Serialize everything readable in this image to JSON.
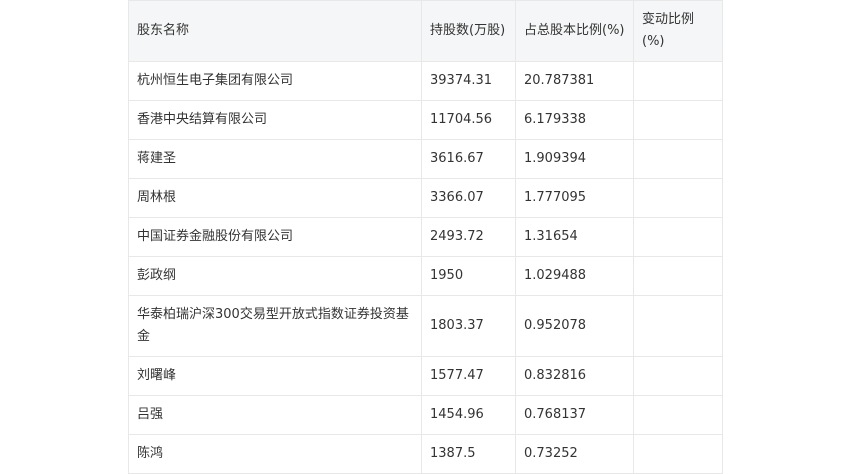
{
  "table": {
    "headers": [
      "股东名称",
      "持股数(万股)",
      "占总股本比例(%)",
      "变动比例(%)"
    ],
    "rows": [
      {
        "name": "杭州恒生电子集团有限公司",
        "shares": "39374.31",
        "ratio": "20.787381",
        "change": ""
      },
      {
        "name": "香港中央结算有限公司",
        "shares": "11704.56",
        "ratio": "6.179338",
        "change": ""
      },
      {
        "name": "蒋建圣",
        "shares": "3616.67",
        "ratio": "1.909394",
        "change": ""
      },
      {
        "name": "周林根",
        "shares": "3366.07",
        "ratio": "1.777095",
        "change": ""
      },
      {
        "name": "中国证券金融股份有限公司",
        "shares": "2493.72",
        "ratio": "1.31654",
        "change": ""
      },
      {
        "name": "彭政纲",
        "shares": "1950",
        "ratio": "1.029488",
        "change": ""
      },
      {
        "name": "华泰柏瑞沪深300交易型开放式指数证券投资基金",
        "shares": "1803.37",
        "ratio": "0.952078",
        "change": ""
      },
      {
        "name": "刘曙峰",
        "shares": "1577.47",
        "ratio": "0.832816",
        "change": ""
      },
      {
        "name": "吕强",
        "shares": "1454.96",
        "ratio": "0.768137",
        "change": ""
      },
      {
        "name": "陈鸿",
        "shares": "1387.5",
        "ratio": "0.73252",
        "change": ""
      }
    ]
  }
}
